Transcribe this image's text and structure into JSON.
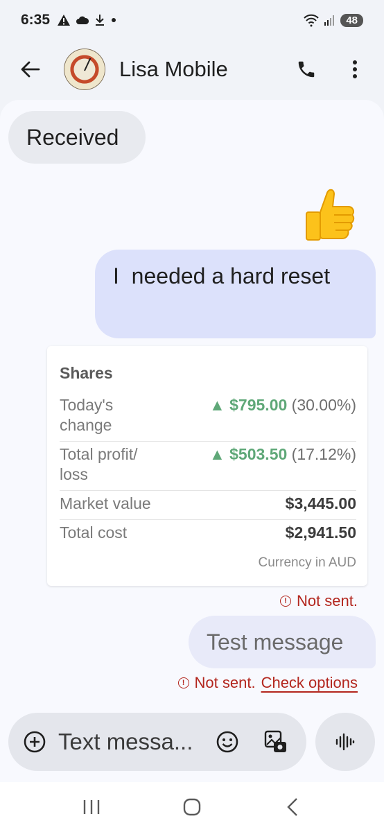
{
  "status_bar": {
    "time": "6:35",
    "battery": "48"
  },
  "header": {
    "contact_name": "Lisa Mobile"
  },
  "messages": {
    "received_text": "Received",
    "thumbs_emoji": "👍",
    "sent_text": "I  needed a hard reset",
    "test_text": "Test message"
  },
  "card": {
    "title": "Shares",
    "rows": [
      {
        "label": "Today's change",
        "arrow": "▲",
        "value": "$795.00",
        "pct": "(30.00%)"
      },
      {
        "label": "Total profit/ loss",
        "arrow": "▲",
        "value": "$503.50",
        "pct": "(17.12%)"
      },
      {
        "label": "Market value",
        "value": "$3,445.00"
      },
      {
        "label": "Total cost",
        "value": "$2,941.50"
      }
    ],
    "currency_note": "Currency in AUD"
  },
  "errors": {
    "not_sent_1": "Not sent.",
    "not_sent_2": "Not sent.",
    "check_options": "Check options"
  },
  "compose": {
    "placeholder": "Text messa..."
  },
  "colors": {
    "accent_bubble": "#dce1fb",
    "error": "#b3261e",
    "gain": "#5fa878"
  },
  "icons": {
    "back": "arrow-left",
    "call": "phone",
    "more": "dots-vertical",
    "add": "plus-circle",
    "emoji": "smiley",
    "gallery": "image",
    "voice": "waveform"
  }
}
